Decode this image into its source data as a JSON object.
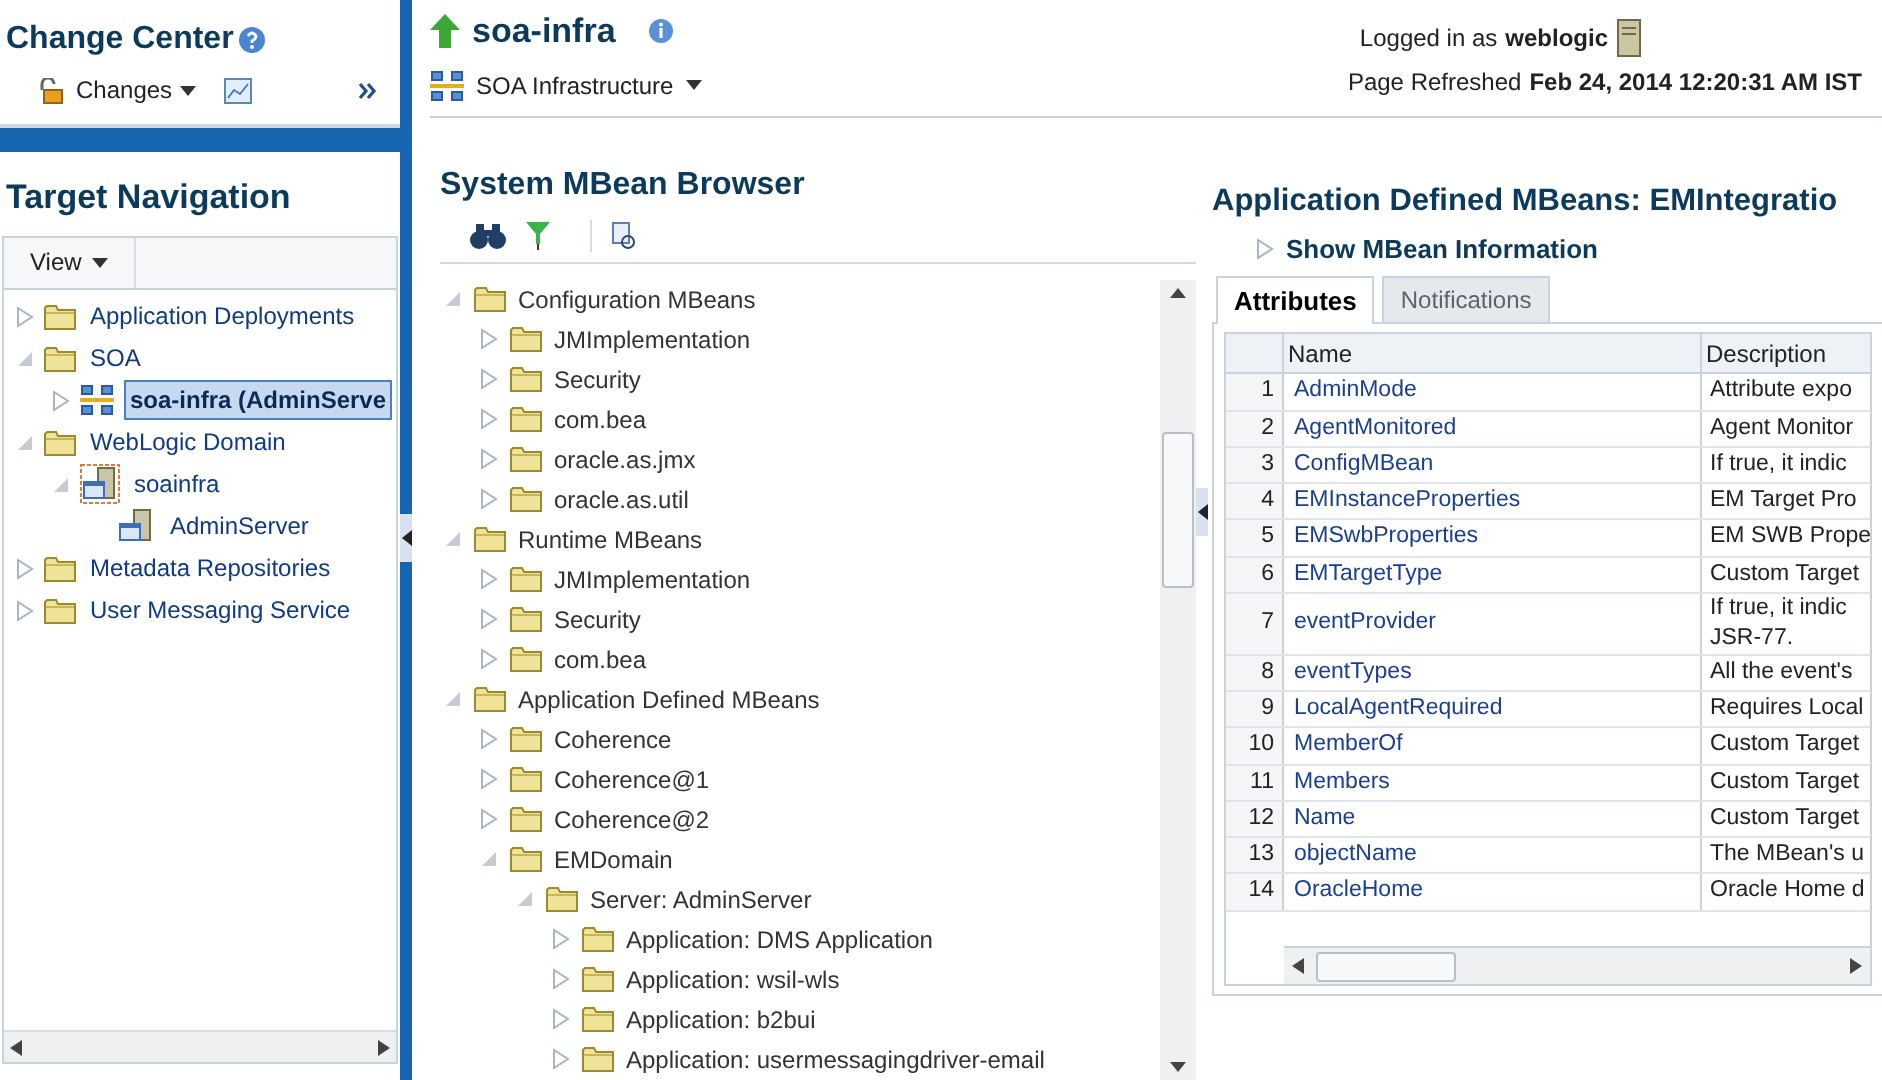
{
  "change_center": {
    "title": "Change Center",
    "changes_menu": {
      "label": "Changes"
    }
  },
  "target_navigation": {
    "title": "Target Navigation",
    "view_menu": {
      "label": "View"
    },
    "tree": [
      {
        "label": "Application Deployments",
        "kind": "folder",
        "expanded": false,
        "selected": false
      },
      {
        "label": "SOA",
        "kind": "folder",
        "expanded": true,
        "selected": false,
        "children": [
          {
            "label": "soa-infra (AdminServe",
            "kind": "soa",
            "expanded": false,
            "selected": true
          }
        ]
      },
      {
        "label": "WebLogic Domain",
        "kind": "folder",
        "expanded": true,
        "selected": false,
        "children": [
          {
            "label": "soainfra",
            "kind": "domain",
            "expanded": true,
            "selected": false,
            "children": [
              {
                "label": "AdminServer",
                "kind": "server",
                "selected": false
              }
            ]
          }
        ]
      },
      {
        "label": "Metadata Repositories",
        "kind": "folder",
        "expanded": false,
        "selected": false
      },
      {
        "label": "User Messaging Service",
        "kind": "folder",
        "expanded": false,
        "selected": false
      }
    ]
  },
  "header": {
    "title": "soa-infra",
    "target_menu": {
      "label": "SOA Infrastructure"
    },
    "logged_in_label": "Logged in as",
    "user": "weblogic",
    "refreshed_label": "Page Refreshed",
    "refreshed_time": "Feb 24, 2014 12:20:31 AM IST"
  },
  "mbean_browser": {
    "title": "System MBean Browser",
    "tree": [
      {
        "label": "Configuration MBeans",
        "expanded": true,
        "children": [
          {
            "label": "JMImplementation",
            "expanded": false
          },
          {
            "label": "Security",
            "expanded": false
          },
          {
            "label": "com.bea",
            "expanded": false
          },
          {
            "label": "oracle.as.jmx",
            "expanded": false
          },
          {
            "label": "oracle.as.util",
            "expanded": false
          }
        ]
      },
      {
        "label": "Runtime MBeans",
        "expanded": true,
        "children": [
          {
            "label": "JMImplementation",
            "expanded": false
          },
          {
            "label": "Security",
            "expanded": false
          },
          {
            "label": "com.bea",
            "expanded": false
          }
        ]
      },
      {
        "label": "Application Defined MBeans",
        "expanded": true,
        "children": [
          {
            "label": "Coherence",
            "expanded": false
          },
          {
            "label": "Coherence@1",
            "expanded": false
          },
          {
            "label": "Coherence@2",
            "expanded": false
          },
          {
            "label": "EMDomain",
            "expanded": true,
            "children": [
              {
                "label": "Server: AdminServer",
                "expanded": true,
                "children": [
                  {
                    "label": "Application: DMS Application",
                    "expanded": false
                  },
                  {
                    "label": "Application: wsil-wls",
                    "expanded": false
                  },
                  {
                    "label": "Application: b2bui",
                    "expanded": false
                  },
                  {
                    "label": "Application: usermessagingdriver-email",
                    "expanded": false
                  }
                ]
              }
            ]
          }
        ]
      }
    ]
  },
  "details": {
    "title": "Application Defined MBeans: EMIntegratio",
    "show_info": "Show MBean Information",
    "tabs": [
      {
        "label": "Attributes",
        "selected": true
      },
      {
        "label": "Notifications",
        "selected": false
      }
    ],
    "table": {
      "columns": [
        "Name",
        "Description"
      ],
      "rows": [
        {
          "index": "1",
          "name": "AdminMode",
          "description": [
            "Attribute expo"
          ]
        },
        {
          "index": "2",
          "name": "AgentMonitored",
          "description": [
            "Agent Monitor"
          ]
        },
        {
          "index": "3",
          "name": "ConfigMBean",
          "description": [
            "If true, it indic"
          ]
        },
        {
          "index": "4",
          "name": "EMInstanceProperties",
          "description": [
            "EM Target Pro"
          ]
        },
        {
          "index": "5",
          "name": "EMSwbProperties",
          "description": [
            "EM SWB Prope"
          ]
        },
        {
          "index": "6",
          "name": "EMTargetType",
          "description": [
            "Custom Target"
          ]
        },
        {
          "index": "7",
          "name": "eventProvider",
          "description": [
            "If true, it indic",
            "JSR-77."
          ]
        },
        {
          "index": "8",
          "name": "eventTypes",
          "description": [
            "All the event's"
          ]
        },
        {
          "index": "9",
          "name": "LocalAgentRequired",
          "description": [
            "Requires Local"
          ]
        },
        {
          "index": "10",
          "name": "MemberOf",
          "description": [
            "Custom Target"
          ]
        },
        {
          "index": "11",
          "name": "Members",
          "description": [
            "Custom Target"
          ]
        },
        {
          "index": "12",
          "name": "Name",
          "description": [
            "Custom Target"
          ]
        },
        {
          "index": "13",
          "name": "objectName",
          "description": [
            "The MBean's u"
          ]
        },
        {
          "index": "14",
          "name": "OracleHome",
          "description": [
            "Oracle Home d"
          ]
        }
      ]
    }
  }
}
